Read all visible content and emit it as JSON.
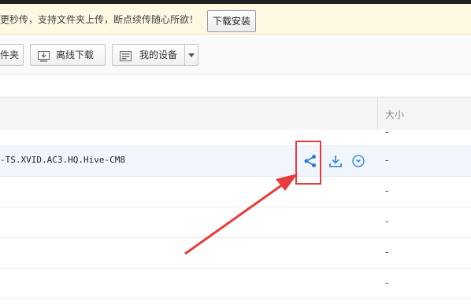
{
  "notice": {
    "text": "更秒传，支持文件夹上传，断点续传随心所欲！",
    "install_button": "下载安装"
  },
  "toolbar": {
    "folder_button": "件夹",
    "offline_download_button": "离线下载",
    "my_devices_button": "我的设备"
  },
  "table": {
    "header": {
      "size": "大小"
    },
    "rows": [
      {
        "name": "",
        "size": "-"
      },
      {
        "name": "-TS.XVID.AC3.HQ.Hive-CM8",
        "size": "-",
        "selected": true
      },
      {
        "name": "",
        "size": "-"
      },
      {
        "name": "",
        "size": "-"
      },
      {
        "name": "",
        "size": "-"
      },
      {
        "name": "",
        "size": "-"
      }
    ]
  },
  "row_actions": [
    "share-icon",
    "download-icon",
    "more-options-icon"
  ],
  "colors": {
    "accent_blue": "#2d7dd2",
    "highlight_red": "#e83b3b",
    "notice_bg": "#fdf8e2",
    "selected_row_bg": "#f1f6fd"
  }
}
